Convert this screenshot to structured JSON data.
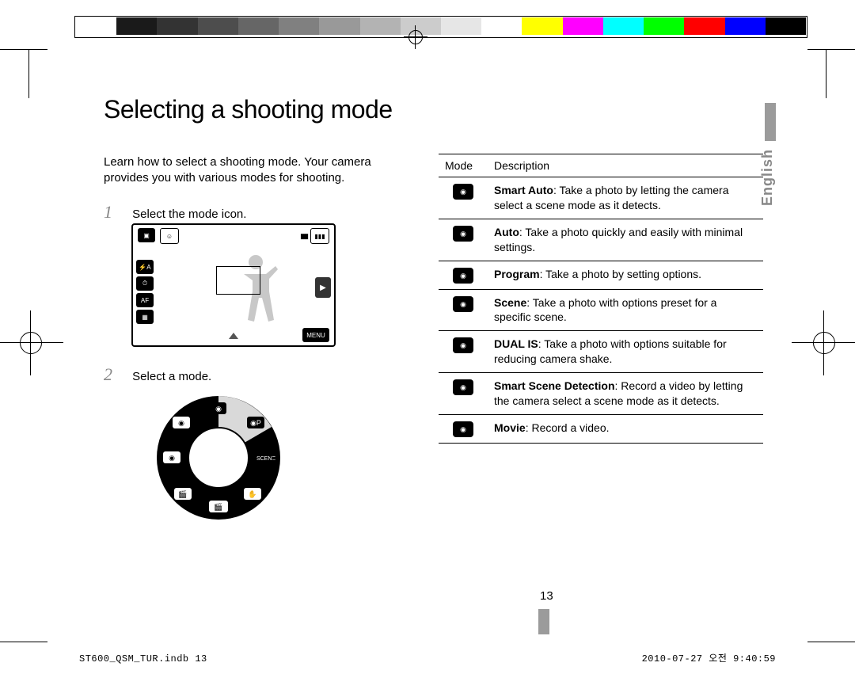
{
  "title": "Selecting a shooting mode",
  "intro": "Learn how to select a shooting mode. Your camera provides you with various modes for shooting.",
  "steps": [
    {
      "num": "1",
      "text": "Select the mode icon."
    },
    {
      "num": "2",
      "text": "Select a mode."
    }
  ],
  "language_tab": "English",
  "lcd": {
    "menu_label": "MENU",
    "top_icons": [
      "camera",
      "portrait"
    ],
    "battery": "▮▮▮",
    "side_icons": [
      "flash-auto",
      "timer",
      "af-off",
      "display"
    ]
  },
  "wheel": {
    "modes_clockwise": [
      "Auto",
      "Program",
      "Scene",
      "DUAL IS",
      "Smart Scene Detection",
      "Movie",
      "Smart Auto"
    ]
  },
  "table": {
    "header": {
      "mode": "Mode",
      "desc": "Description"
    },
    "rows": [
      {
        "icon": "smart-auto",
        "bold": "Smart Auto",
        "text": ": Take a photo by letting the camera select a scene mode as it detects."
      },
      {
        "icon": "auto",
        "bold": "Auto",
        "text": ": Take a photo quickly and easily with minimal settings."
      },
      {
        "icon": "program",
        "bold": "Program",
        "text": ": Take a photo by setting options."
      },
      {
        "icon": "scene",
        "bold": "Scene",
        "text": ": Take a photo with options preset for a specific scene."
      },
      {
        "icon": "dual-is",
        "bold": "DUAL IS",
        "text": ": Take a photo with options suitable for reducing camera shake."
      },
      {
        "icon": "smart-scene-detection",
        "bold": "Smart Scene Detection",
        "text": ": Record a video by letting the camera select a scene mode as it detects."
      },
      {
        "icon": "movie",
        "bold": "Movie",
        "text": ": Record a video."
      }
    ]
  },
  "page_number": "13",
  "footer": {
    "left": "ST600_QSM_TUR.indb   13",
    "right": "2010-07-27   오전 9:40:59"
  }
}
